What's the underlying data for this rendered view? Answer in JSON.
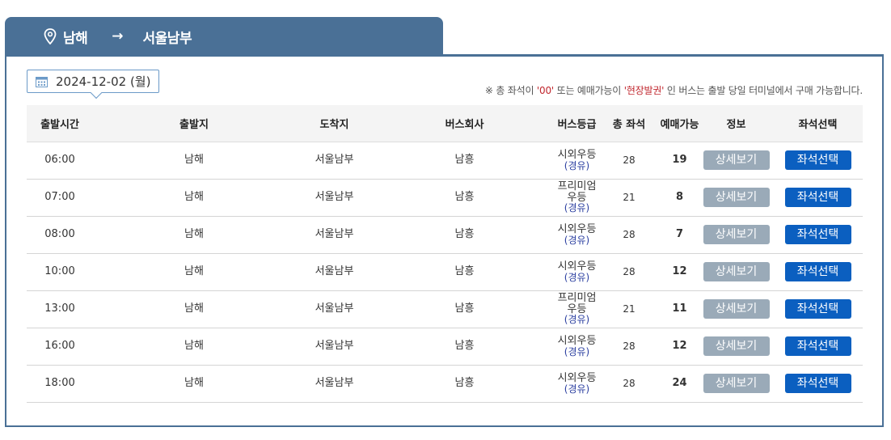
{
  "route": {
    "origin": "남해",
    "arrow": "→",
    "destination": "서울남부",
    "icon": "location-pin-icon"
  },
  "date": {
    "label": "2024-12-02 (월)",
    "icon": "calendar-icon"
  },
  "notice": {
    "prefix": "※ 총 좌석이 ",
    "highlight1": "'00'",
    "middle": " 또는 예매가능이 ",
    "highlight2": "'현장발권'",
    "suffix": " 인 버스는 출발 당일 터미널에서 구매 가능합니다."
  },
  "table": {
    "headers": [
      "출발시간",
      "출발지",
      "도착지",
      "버스회사",
      "버스등급",
      "총 좌석",
      "예매가능",
      "정보",
      "좌석선택"
    ],
    "rows": [
      {
        "time": "06:00",
        "from": "남해",
        "to": "서울남부",
        "company": "남흥",
        "grade": "시외우등",
        "grade_sub": "(경유)",
        "seats": "28",
        "available": "19",
        "detail": "상세보기",
        "select": "좌석선택"
      },
      {
        "time": "07:00",
        "from": "남해",
        "to": "서울남부",
        "company": "남흥",
        "grade": "프리미엄우등",
        "grade_sub": "(경유)",
        "seats": "21",
        "available": "8",
        "detail": "상세보기",
        "select": "좌석선택"
      },
      {
        "time": "08:00",
        "from": "남해",
        "to": "서울남부",
        "company": "남흥",
        "grade": "시외우등",
        "grade_sub": "(경유)",
        "seats": "28",
        "available": "7",
        "detail": "상세보기",
        "select": "좌석선택"
      },
      {
        "time": "10:00",
        "from": "남해",
        "to": "서울남부",
        "company": "남흥",
        "grade": "시외우등",
        "grade_sub": "(경유)",
        "seats": "28",
        "available": "12",
        "detail": "상세보기",
        "select": "좌석선택"
      },
      {
        "time": "13:00",
        "from": "남해",
        "to": "서울남부",
        "company": "남흥",
        "grade": "프리미엄우등",
        "grade_sub": "(경유)",
        "seats": "21",
        "available": "11",
        "detail": "상세보기",
        "select": "좌석선택"
      },
      {
        "time": "16:00",
        "from": "남해",
        "to": "서울남부",
        "company": "남흥",
        "grade": "시외우등",
        "grade_sub": "(경유)",
        "seats": "28",
        "available": "12",
        "detail": "상세보기",
        "select": "좌석선택"
      },
      {
        "time": "18:00",
        "from": "남해",
        "to": "서울남부",
        "company": "남흥",
        "grade": "시외우등",
        "grade_sub": "(경유)",
        "seats": "28",
        "available": "24",
        "detail": "상세보기",
        "select": "좌석선택"
      }
    ]
  },
  "colors": {
    "header_blue": "#4a7096",
    "seat_button": "#0b5fc0",
    "detail_button": "#9aaab8",
    "notice_red": "#c0262d"
  }
}
